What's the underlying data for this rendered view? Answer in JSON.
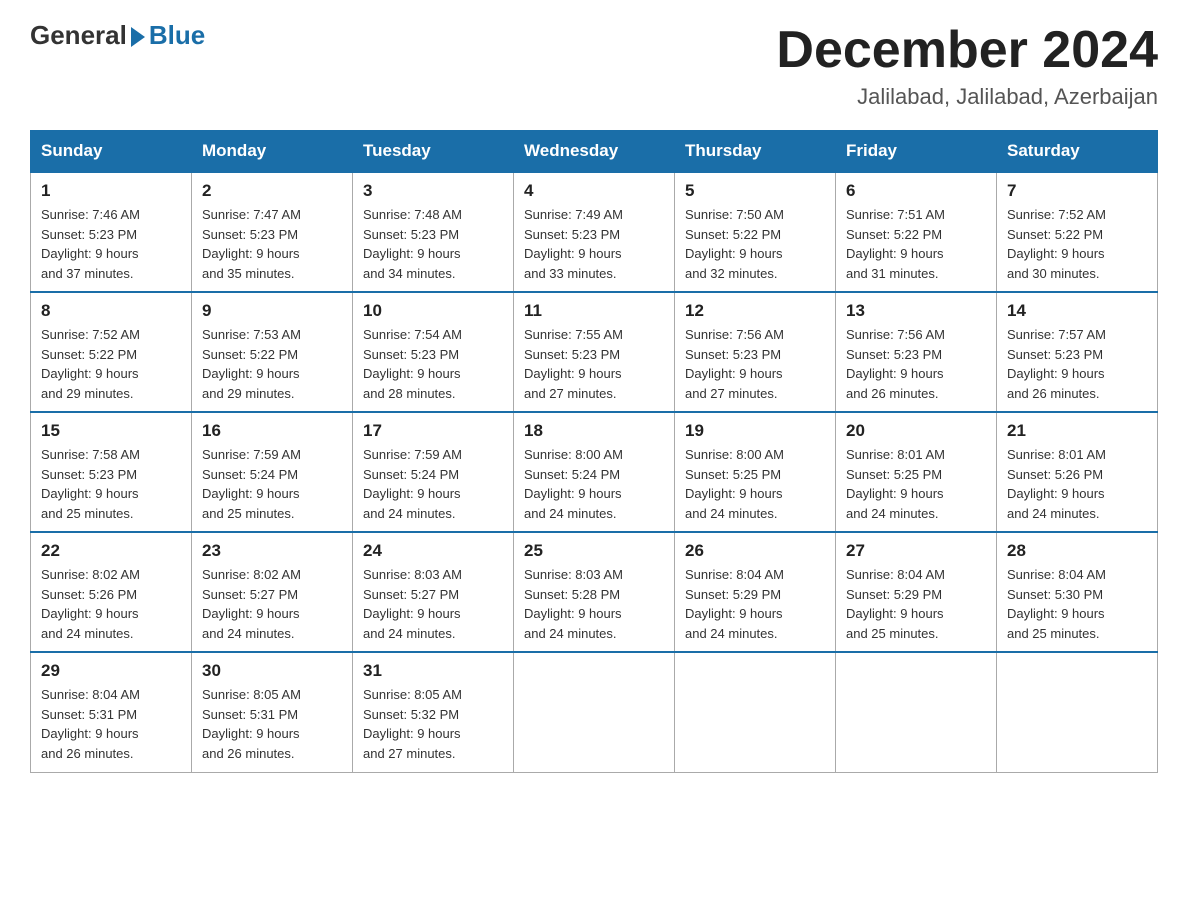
{
  "logo": {
    "general": "General",
    "blue": "Blue"
  },
  "title": "December 2024",
  "location": "Jalilabad, Jalilabad, Azerbaijan",
  "days_header": [
    "Sunday",
    "Monday",
    "Tuesday",
    "Wednesday",
    "Thursday",
    "Friday",
    "Saturday"
  ],
  "weeks": [
    [
      {
        "day": "1",
        "sunrise": "7:46 AM",
        "sunset": "5:23 PM",
        "daylight": "9 hours and 37 minutes."
      },
      {
        "day": "2",
        "sunrise": "7:47 AM",
        "sunset": "5:23 PM",
        "daylight": "9 hours and 35 minutes."
      },
      {
        "day": "3",
        "sunrise": "7:48 AM",
        "sunset": "5:23 PM",
        "daylight": "9 hours and 34 minutes."
      },
      {
        "day": "4",
        "sunrise": "7:49 AM",
        "sunset": "5:23 PM",
        "daylight": "9 hours and 33 minutes."
      },
      {
        "day": "5",
        "sunrise": "7:50 AM",
        "sunset": "5:22 PM",
        "daylight": "9 hours and 32 minutes."
      },
      {
        "day": "6",
        "sunrise": "7:51 AM",
        "sunset": "5:22 PM",
        "daylight": "9 hours and 31 minutes."
      },
      {
        "day": "7",
        "sunrise": "7:52 AM",
        "sunset": "5:22 PM",
        "daylight": "9 hours and 30 minutes."
      }
    ],
    [
      {
        "day": "8",
        "sunrise": "7:52 AM",
        "sunset": "5:22 PM",
        "daylight": "9 hours and 29 minutes."
      },
      {
        "day": "9",
        "sunrise": "7:53 AM",
        "sunset": "5:22 PM",
        "daylight": "9 hours and 29 minutes."
      },
      {
        "day": "10",
        "sunrise": "7:54 AM",
        "sunset": "5:23 PM",
        "daylight": "9 hours and 28 minutes."
      },
      {
        "day": "11",
        "sunrise": "7:55 AM",
        "sunset": "5:23 PM",
        "daylight": "9 hours and 27 minutes."
      },
      {
        "day": "12",
        "sunrise": "7:56 AM",
        "sunset": "5:23 PM",
        "daylight": "9 hours and 27 minutes."
      },
      {
        "day": "13",
        "sunrise": "7:56 AM",
        "sunset": "5:23 PM",
        "daylight": "9 hours and 26 minutes."
      },
      {
        "day": "14",
        "sunrise": "7:57 AM",
        "sunset": "5:23 PM",
        "daylight": "9 hours and 26 minutes."
      }
    ],
    [
      {
        "day": "15",
        "sunrise": "7:58 AM",
        "sunset": "5:23 PM",
        "daylight": "9 hours and 25 minutes."
      },
      {
        "day": "16",
        "sunrise": "7:59 AM",
        "sunset": "5:24 PM",
        "daylight": "9 hours and 25 minutes."
      },
      {
        "day": "17",
        "sunrise": "7:59 AM",
        "sunset": "5:24 PM",
        "daylight": "9 hours and 24 minutes."
      },
      {
        "day": "18",
        "sunrise": "8:00 AM",
        "sunset": "5:24 PM",
        "daylight": "9 hours and 24 minutes."
      },
      {
        "day": "19",
        "sunrise": "8:00 AM",
        "sunset": "5:25 PM",
        "daylight": "9 hours and 24 minutes."
      },
      {
        "day": "20",
        "sunrise": "8:01 AM",
        "sunset": "5:25 PM",
        "daylight": "9 hours and 24 minutes."
      },
      {
        "day": "21",
        "sunrise": "8:01 AM",
        "sunset": "5:26 PM",
        "daylight": "9 hours and 24 minutes."
      }
    ],
    [
      {
        "day": "22",
        "sunrise": "8:02 AM",
        "sunset": "5:26 PM",
        "daylight": "9 hours and 24 minutes."
      },
      {
        "day": "23",
        "sunrise": "8:02 AM",
        "sunset": "5:27 PM",
        "daylight": "9 hours and 24 minutes."
      },
      {
        "day": "24",
        "sunrise": "8:03 AM",
        "sunset": "5:27 PM",
        "daylight": "9 hours and 24 minutes."
      },
      {
        "day": "25",
        "sunrise": "8:03 AM",
        "sunset": "5:28 PM",
        "daylight": "9 hours and 24 minutes."
      },
      {
        "day": "26",
        "sunrise": "8:04 AM",
        "sunset": "5:29 PM",
        "daylight": "9 hours and 24 minutes."
      },
      {
        "day": "27",
        "sunrise": "8:04 AM",
        "sunset": "5:29 PM",
        "daylight": "9 hours and 25 minutes."
      },
      {
        "day": "28",
        "sunrise": "8:04 AM",
        "sunset": "5:30 PM",
        "daylight": "9 hours and 25 minutes."
      }
    ],
    [
      {
        "day": "29",
        "sunrise": "8:04 AM",
        "sunset": "5:31 PM",
        "daylight": "9 hours and 26 minutes."
      },
      {
        "day": "30",
        "sunrise": "8:05 AM",
        "sunset": "5:31 PM",
        "daylight": "9 hours and 26 minutes."
      },
      {
        "day": "31",
        "sunrise": "8:05 AM",
        "sunset": "5:32 PM",
        "daylight": "9 hours and 27 minutes."
      },
      null,
      null,
      null,
      null
    ]
  ],
  "labels": {
    "sunrise": "Sunrise:",
    "sunset": "Sunset:",
    "daylight": "Daylight:"
  }
}
